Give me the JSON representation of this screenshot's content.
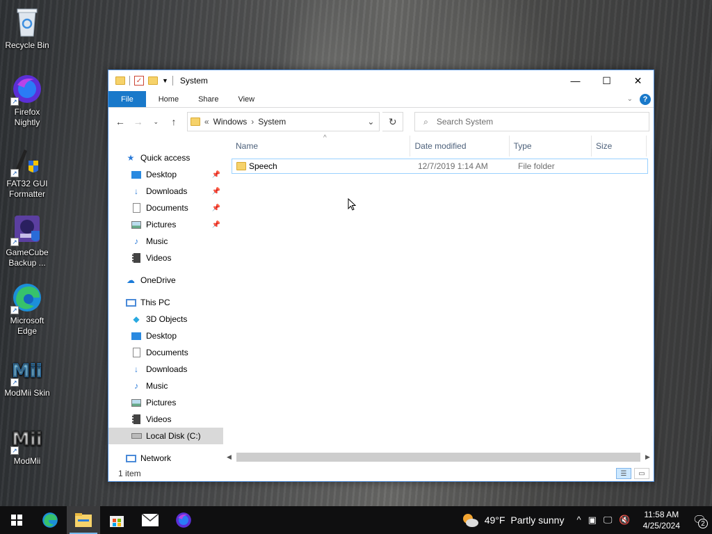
{
  "desktop": {
    "icons": [
      {
        "label": "Recycle Bin"
      },
      {
        "label": "Firefox Nightly"
      },
      {
        "label": "FAT32 GUI Formatter"
      },
      {
        "label": "GameCube Backup ..."
      },
      {
        "label": "Microsoft Edge"
      },
      {
        "label": "ModMii Skin"
      },
      {
        "label": "ModMii"
      }
    ]
  },
  "window": {
    "title": "System",
    "controls": {
      "minimize": "—",
      "maximize": "☐",
      "close": "✕"
    },
    "ribbon": {
      "tabs": [
        "File",
        "Home",
        "Share",
        "View"
      ],
      "help": "?"
    },
    "address": {
      "overflow": "«",
      "crumbs": [
        "Windows",
        "System"
      ],
      "separator": "›"
    },
    "search": {
      "placeholder": "Search System"
    },
    "nav_pane": {
      "quick_access": {
        "label": "Quick access",
        "items": [
          {
            "label": "Desktop",
            "pinned": true
          },
          {
            "label": "Downloads",
            "pinned": true
          },
          {
            "label": "Documents",
            "pinned": true
          },
          {
            "label": "Pictures",
            "pinned": true
          },
          {
            "label": "Music",
            "pinned": false
          },
          {
            "label": "Videos",
            "pinned": false
          }
        ]
      },
      "onedrive": "OneDrive",
      "this_pc": {
        "label": "This PC",
        "items": [
          "3D Objects",
          "Desktop",
          "Documents",
          "Downloads",
          "Music",
          "Pictures",
          "Videos",
          "Local Disk (C:)"
        ],
        "selected": "Local Disk (C:)"
      },
      "network": "Network"
    },
    "columns": [
      "Name",
      "Date modified",
      "Type",
      "Size"
    ],
    "files": [
      {
        "name": "Speech",
        "date_modified": "12/7/2019 1:14 AM",
        "type": "File folder",
        "size": ""
      }
    ],
    "status": "1 item"
  },
  "taskbar": {
    "weather": {
      "temp": "49°F",
      "condition": "Partly sunny"
    },
    "time": "11:58 AM",
    "date": "4/25/2024",
    "notifications": "2"
  },
  "colors": {
    "accent": "#1979ca",
    "selection_border": "#99d1ff",
    "folder": "#f6d26a"
  }
}
